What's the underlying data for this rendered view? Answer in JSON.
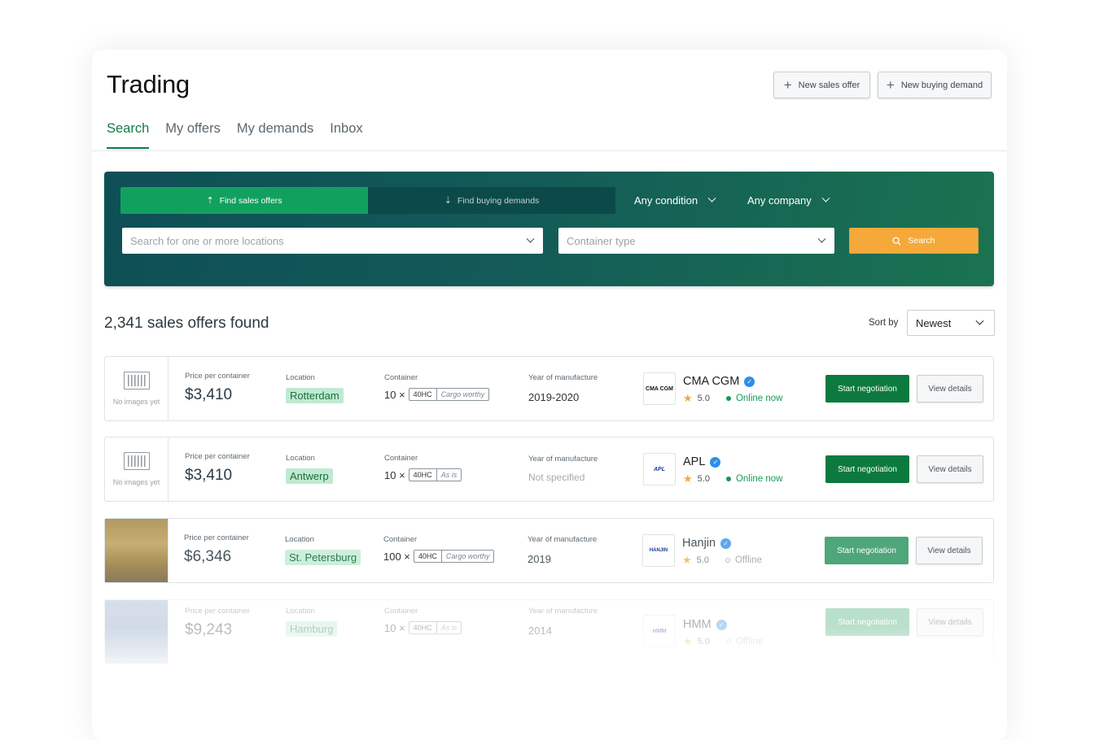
{
  "header": {
    "title": "Trading",
    "new_sales_offer": "New sales offer",
    "new_buying_demand": "New buying demand"
  },
  "tabs": [
    {
      "label": "Search",
      "active": true
    },
    {
      "label": "My offers"
    },
    {
      "label": "My demands"
    },
    {
      "label": "Inbox"
    }
  ],
  "search": {
    "mode_sales": "Find sales offers",
    "mode_demands": "Find buying demands",
    "condition": "Any condition",
    "company": "Any company",
    "location_placeholder": "Search for one or more locations",
    "container_placeholder": "Container type",
    "search_button": "Search"
  },
  "results": {
    "count_text": "2,341 sales offers found",
    "sort_label": "Sort by",
    "sort_value": "Newest"
  },
  "labels": {
    "price": "Price per container",
    "location": "Location",
    "container": "Container",
    "year": "Year of manufacture",
    "no_images": "No images yet",
    "start_negotiation": "Start negotiation",
    "view_details": "View details",
    "online": "Online now",
    "offline": "Offline"
  },
  "offers": [
    {
      "price": "$3,410",
      "location": "Rotterdam",
      "qty": "10 ×",
      "code": "40HC",
      "condition": "Cargo worthy",
      "year": "2019-2020",
      "company": "CMA CGM",
      "logo": "CMA CGM",
      "rating": "5.0",
      "online": true
    },
    {
      "price": "$3,410",
      "location": "Antwerp",
      "qty": "10 ×",
      "code": "40HC",
      "condition": "As is",
      "year": "Not specified",
      "company": "APL",
      "logo": "APL",
      "rating": "5.0",
      "online": true
    },
    {
      "price": "$6,346",
      "location": "St. Petersburg",
      "qty": "100 ×",
      "code": "40HC",
      "condition": "Cargo worthy",
      "year": "2019",
      "company": "Hanjin",
      "logo": "HANJIN",
      "rating": "5.0",
      "online": false
    },
    {
      "price": "$9,243",
      "location": "Hamburg",
      "qty": "10 ×",
      "code": "40HC",
      "condition": "As is",
      "year": "2014",
      "company": "HMM",
      "logo": "HMM",
      "rating": "5.0",
      "online": false
    }
  ],
  "colors": {
    "brand_green": "#137a4a",
    "accent_orange": "#f4a93a",
    "panel_dark": "#0e4f56"
  }
}
